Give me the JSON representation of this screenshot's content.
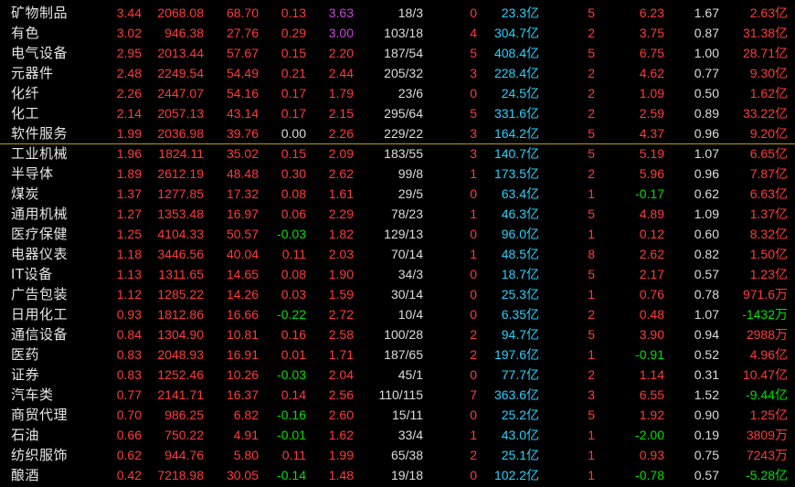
{
  "palette": {
    "background": "#000000",
    "name": "#e6e6e6",
    "up": "#ff3a3a",
    "down": "#00e000",
    "neutral": "#dcdcdc",
    "amount": "#22d4ff",
    "highlight": "#cc44dd",
    "divider": "#b39c00"
  },
  "rows": [
    {
      "name": "矿物制品",
      "values": [
        "3.44",
        "2068.08",
        "68.70",
        "0.13",
        "3.63",
        "18/3",
        "0",
        "23.3亿",
        "5",
        "6.23",
        "1.67",
        "2.63亿"
      ]
    },
    {
      "name": "有色",
      "values": [
        "3.02",
        "946.38",
        "27.76",
        "0.29",
        "3.00",
        "103/18",
        "4",
        "304.7亿",
        "2",
        "3.75",
        "0.87",
        "31.38亿"
      ]
    },
    {
      "name": "电气设备",
      "values": [
        "2.95",
        "2013.44",
        "57.67",
        "0.15",
        "2.20",
        "187/54",
        "5",
        "408.4亿",
        "5",
        "6.75",
        "1.00",
        "28.71亿"
      ]
    },
    {
      "name": "元器件",
      "values": [
        "2.48",
        "2249.54",
        "54.49",
        "0.21",
        "2.44",
        "205/32",
        "3",
        "228.4亿",
        "2",
        "4.62",
        "0.77",
        "9.30亿"
      ]
    },
    {
      "name": "化纤",
      "values": [
        "2.26",
        "2447.07",
        "54.16",
        "0.17",
        "1.79",
        "23/6",
        "0",
        "24.5亿",
        "2",
        "1.09",
        "0.50",
        "1.62亿"
      ]
    },
    {
      "name": "化工",
      "values": [
        "2.14",
        "2057.13",
        "43.14",
        "0.17",
        "2.15",
        "295/64",
        "5",
        "331.6亿",
        "2",
        "2.59",
        "0.89",
        "33.22亿"
      ]
    },
    {
      "name": "软件服务",
      "values": [
        "1.99",
        "2036.98",
        "39.76",
        "0.00",
        "2.26",
        "229/22",
        "3",
        "164.2亿",
        "5",
        "4.37",
        "0.96",
        "9.20亿"
      ]
    },
    {
      "name": "工业机械",
      "values": [
        "1.96",
        "1824.11",
        "35.02",
        "0.15",
        "2.09",
        "183/55",
        "3",
        "140.7亿",
        "5",
        "5.19",
        "1.07",
        "6.65亿"
      ]
    },
    {
      "name": "半导体",
      "values": [
        "1.89",
        "2612.19",
        "48.48",
        "0.30",
        "2.62",
        "99/8",
        "1",
        "173.5亿",
        "2",
        "5.96",
        "0.96",
        "7.87亿"
      ]
    },
    {
      "name": "煤炭",
      "values": [
        "1.37",
        "1277.85",
        "17.32",
        "0.08",
        "1.61",
        "29/5",
        "0",
        "63.4亿",
        "1",
        "-0.17",
        "0.62",
        "6.63亿"
      ]
    },
    {
      "name": "通用机械",
      "values": [
        "1.27",
        "1353.48",
        "16.97",
        "0.06",
        "2.29",
        "78/23",
        "1",
        "46.3亿",
        "5",
        "4.89",
        "1.09",
        "1.37亿"
      ]
    },
    {
      "name": "医疗保健",
      "values": [
        "1.25",
        "4104.33",
        "50.57",
        "-0.03",
        "1.82",
        "129/13",
        "0",
        "96.0亿",
        "1",
        "0.12",
        "0.60",
        "8.32亿"
      ]
    },
    {
      "name": "电器仪表",
      "values": [
        "1.18",
        "3446.56",
        "40.04",
        "0.11",
        "2.03",
        "70/14",
        "1",
        "48.5亿",
        "8",
        "2.62",
        "0.82",
        "1.50亿"
      ]
    },
    {
      "name": "IT设备",
      "values": [
        "1.13",
        "1311.65",
        "14.65",
        "0.08",
        "1.90",
        "34/3",
        "0",
        "18.7亿",
        "5",
        "2.17",
        "0.57",
        "1.23亿"
      ]
    },
    {
      "name": "广告包装",
      "values": [
        "1.12",
        "1285.22",
        "14.26",
        "0.03",
        "1.59",
        "30/14",
        "0",
        "25.3亿",
        "1",
        "0.76",
        "0.78",
        "971.6万"
      ]
    },
    {
      "name": "日用化工",
      "values": [
        "0.93",
        "1812.86",
        "16.66",
        "-0.22",
        "2.72",
        "10/4",
        "0",
        "6.35亿",
        "2",
        "0.48",
        "1.07",
        "-1432万"
      ]
    },
    {
      "name": "通信设备",
      "values": [
        "0.84",
        "1304.90",
        "10.81",
        "0.16",
        "2.58",
        "100/28",
        "2",
        "94.7亿",
        "5",
        "3.90",
        "0.94",
        "2988万"
      ]
    },
    {
      "name": "医药",
      "values": [
        "0.83",
        "2048.93",
        "16.91",
        "0.01",
        "1.71",
        "187/65",
        "2",
        "197.6亿",
        "1",
        "-0.91",
        "0.52",
        "4.96亿"
      ]
    },
    {
      "name": "证券",
      "values": [
        "0.83",
        "1252.46",
        "10.26",
        "-0.03",
        "2.04",
        "45/1",
        "0",
        "77.7亿",
        "2",
        "1.14",
        "0.31",
        "10.47亿"
      ]
    },
    {
      "name": "汽车类",
      "values": [
        "0.77",
        "2141.71",
        "16.37",
        "0.14",
        "2.56",
        "110/115",
        "7",
        "363.6亿",
        "3",
        "6.55",
        "1.52",
        "-9.44亿"
      ]
    },
    {
      "name": "商贸代理",
      "values": [
        "0.70",
        "986.25",
        "6.82",
        "-0.16",
        "2.60",
        "15/11",
        "0",
        "25.2亿",
        "5",
        "1.92",
        "0.90",
        "1.25亿"
      ]
    },
    {
      "name": "石油",
      "values": [
        "0.66",
        "750.22",
        "4.91",
        "-0.01",
        "1.62",
        "33/4",
        "1",
        "43.0亿",
        "1",
        "-2.00",
        "0.19",
        "3809万"
      ]
    },
    {
      "name": "纺织服饰",
      "values": [
        "0.62",
        "944.76",
        "5.80",
        "0.11",
        "1.99",
        "65/38",
        "2",
        "25.1亿",
        "1",
        "0.93",
        "0.75",
        "7243万"
      ]
    },
    {
      "name": "酿酒",
      "values": [
        "0.42",
        "7218.98",
        "30.05",
        "-0.14",
        "1.48",
        "19/18",
        "0",
        "102.2亿",
        "1",
        "-0.78",
        "0.57",
        "-5.28亿"
      ]
    }
  ]
}
